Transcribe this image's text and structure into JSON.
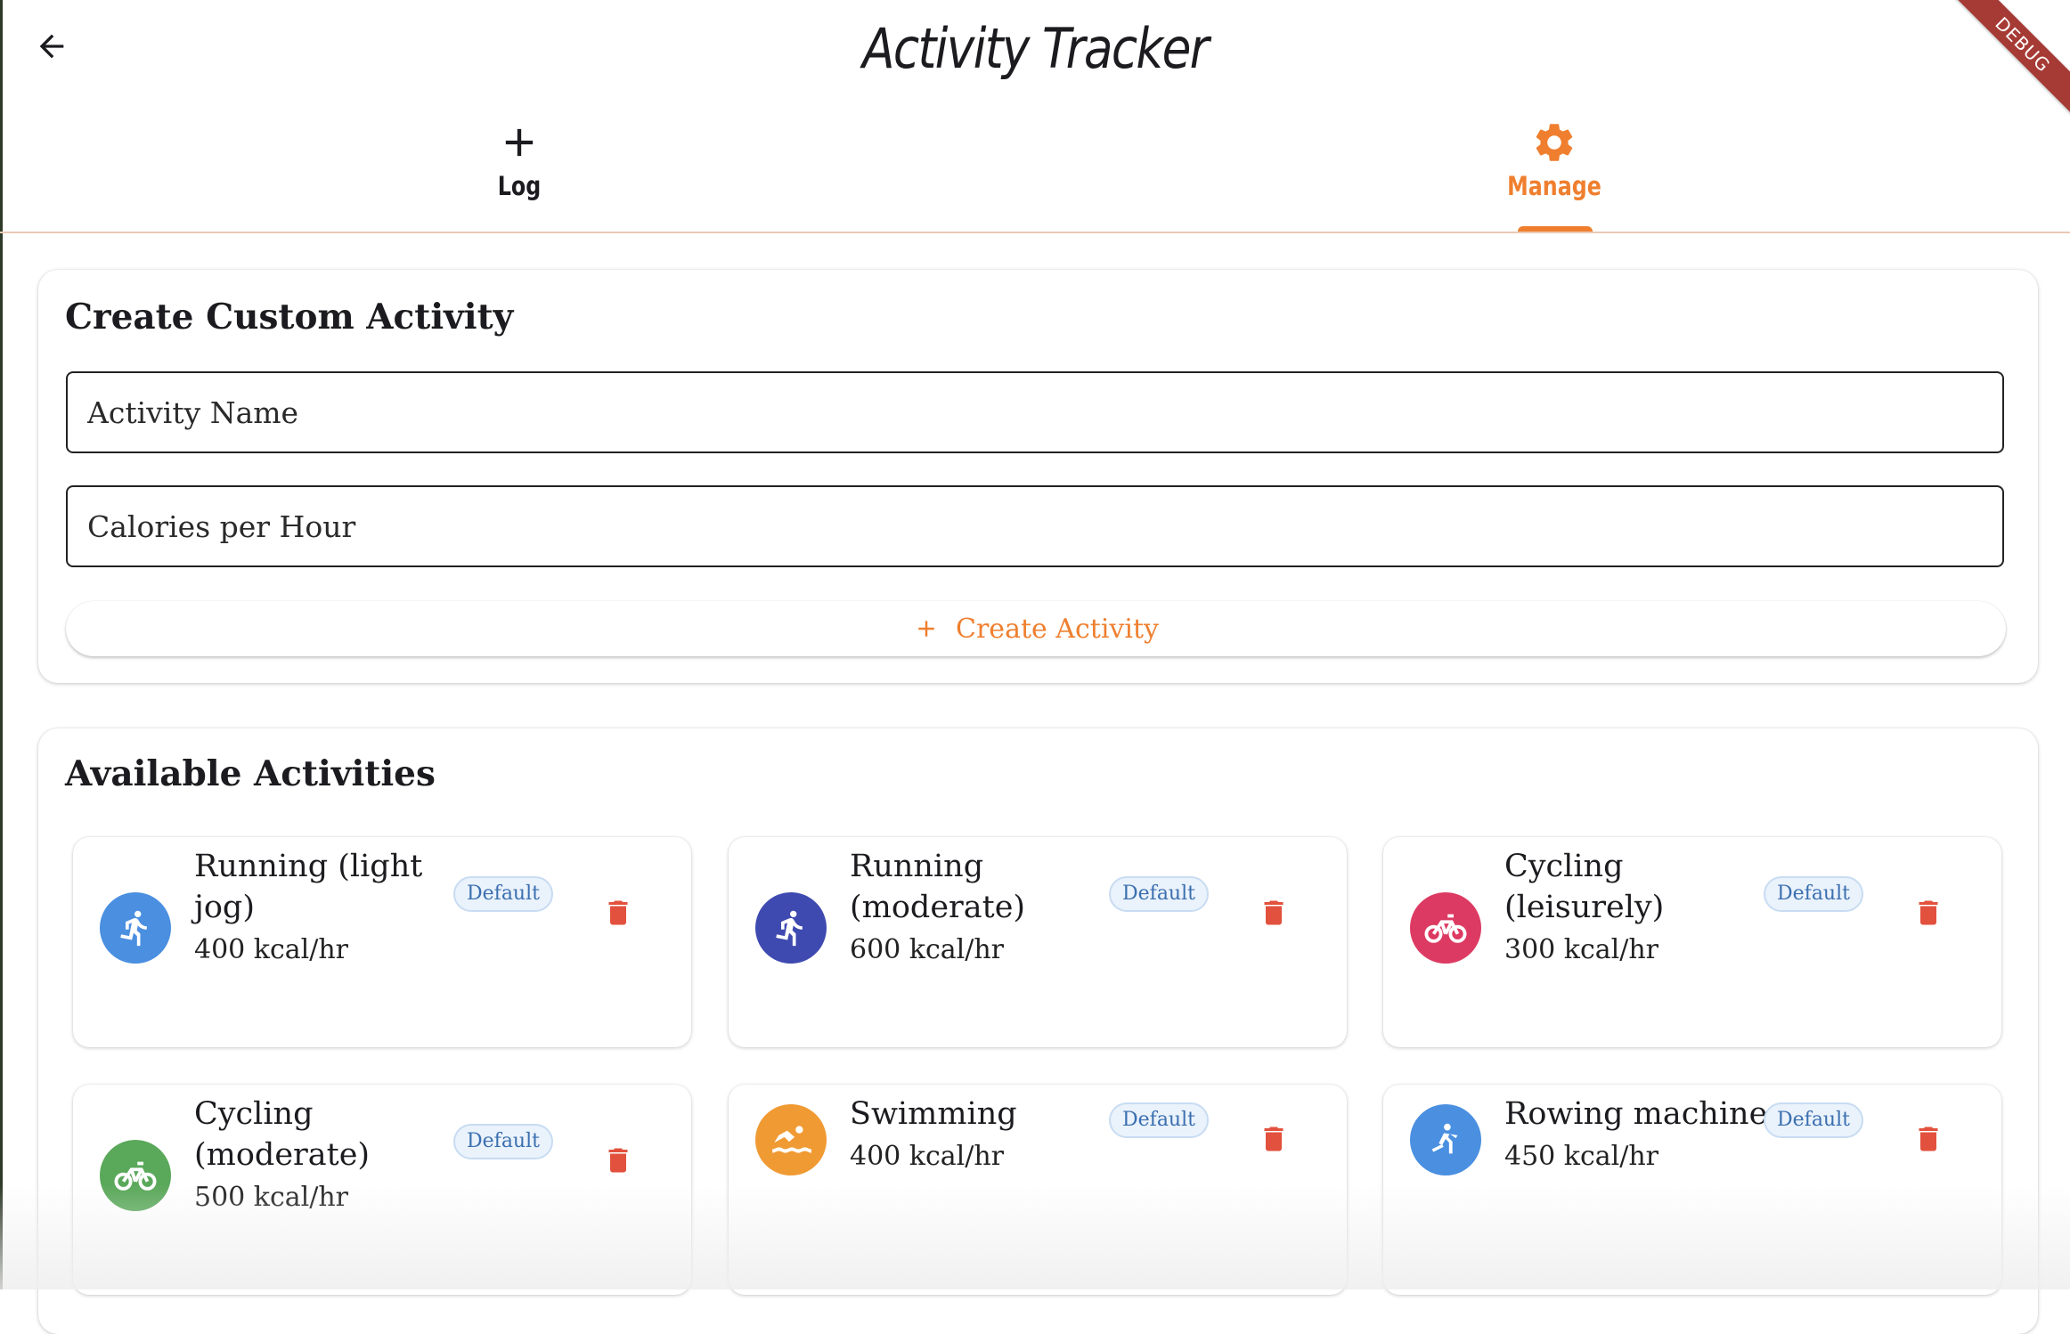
{
  "app": {
    "title": "Activity Tracker",
    "debug_label": "DEBUG",
    "accent_color": "#ef7f2f"
  },
  "tabs": [
    {
      "label": "Log",
      "icon": "plus-icon",
      "selected": false
    },
    {
      "label": "Manage",
      "icon": "gear-icon",
      "selected": true
    }
  ],
  "create_form": {
    "title": "Create Custom Activity",
    "name_placeholder": "Activity Name",
    "name_value": "",
    "calories_placeholder": "Calories per Hour",
    "calories_value": "",
    "button_label": "Create Activity",
    "button_icon": "plus-icon"
  },
  "activities": {
    "title": "Available Activities",
    "items": [
      {
        "name": "Running (light jog)",
        "kcal": "400 kcal/hr",
        "badge": "Default",
        "icon": "running-icon",
        "color": "#4a8fe0"
      },
      {
        "name": "Running (moderate)",
        "kcal": "600 kcal/hr",
        "badge": "Default",
        "icon": "running-icon",
        "color": "#3f4ab0"
      },
      {
        "name": "Cycling (leisurely)",
        "kcal": "300 kcal/hr",
        "badge": "Default",
        "icon": "bicycle-icon",
        "color": "#dc3a62"
      },
      {
        "name": "Cycling (moderate)",
        "kcal": "500 kcal/hr",
        "badge": "Default",
        "icon": "bicycle-icon",
        "color": "#5aa85a"
      },
      {
        "name": "Swimming",
        "kcal": "400 kcal/hr",
        "badge": "Default",
        "icon": "swimming-icon",
        "color": "#f09a33"
      },
      {
        "name": "Rowing machine",
        "kcal": "450 kcal/hr",
        "badge": "Default",
        "icon": "rowing-icon",
        "color": "#4a8fe0"
      }
    ]
  },
  "colors": {
    "delete": "#e2513d",
    "badge_text": "#3a6fb0"
  }
}
